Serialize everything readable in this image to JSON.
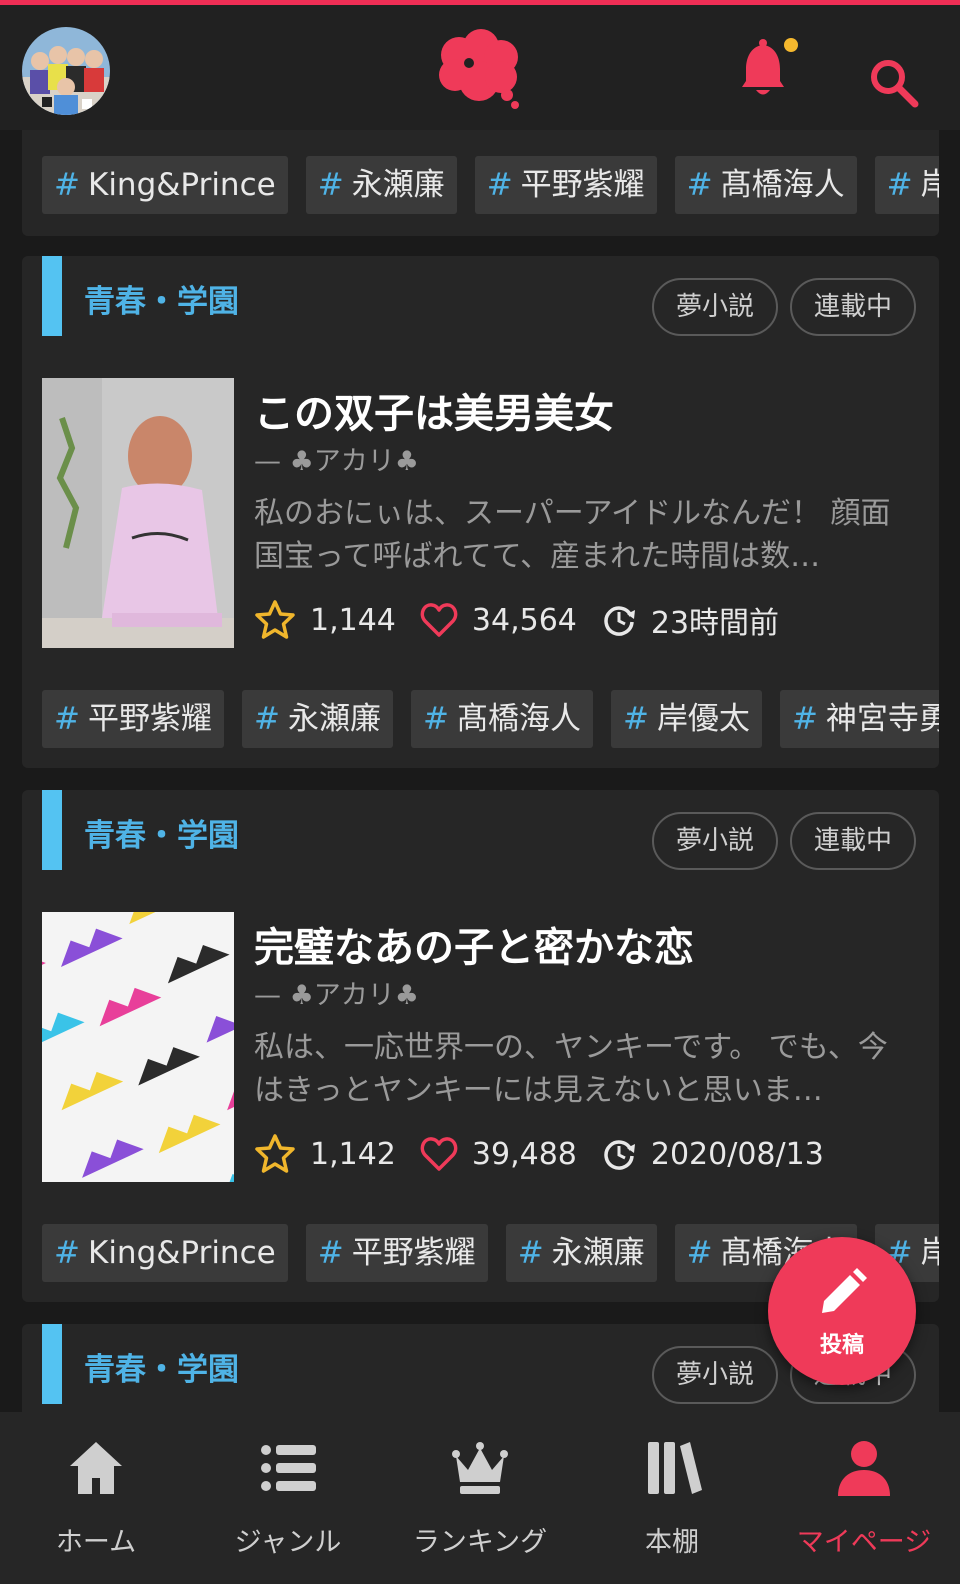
{
  "header": {
    "avatar_icon": "avatar-photo",
    "logo_icon": "speech-bubble-logo-icon",
    "notification_icon": "bell-icon",
    "search_icon": "search-icon"
  },
  "top_tags": [
    "King&Prince",
    "永瀬廉",
    "平野紫耀",
    "髙橋海人",
    "岸優"
  ],
  "cards": [
    {
      "genre": "青春・学園",
      "badge1": "夢小説",
      "badge2": "連載中",
      "title": "この双子は美男美女",
      "author": "— ♣アカリ♣",
      "description": "私のおにぃは、スーパーアイドルなんだ！ 顔面国宝って呼ばれてて、産まれた時間は数…",
      "stars": "1,144",
      "likes": "34,564",
      "updated": "23時間前",
      "tags": [
        "平野紫耀",
        "永瀬廉",
        "髙橋海人",
        "岸優太",
        "神宮寺勇"
      ]
    },
    {
      "genre": "青春・学園",
      "badge1": "夢小説",
      "badge2": "連載中",
      "title": "完璧なあの子と密かな恋",
      "author": "— ♣アカリ♣",
      "description": "私は、一応世界一の、ヤンキーです。 でも、今はきっとヤンキーには見えないと思いま…",
      "stars": "1,142",
      "likes": "39,488",
      "updated": "2020/08/13",
      "tags": [
        "King&Prince",
        "平野紫耀",
        "永瀬廉",
        "髙橋海人",
        "岸優"
      ]
    },
    {
      "genre": "青春・学園",
      "badge1": "夢小説",
      "badge2": "連載中"
    }
  ],
  "fab": {
    "label": "投稿",
    "icon": "pencil-icon"
  },
  "nav": [
    {
      "label": "ホーム",
      "icon": "home-icon"
    },
    {
      "label": "ジャンル",
      "icon": "list-icon"
    },
    {
      "label": "ランキング",
      "icon": "crown-icon"
    },
    {
      "label": "本棚",
      "icon": "bookshelf-icon"
    },
    {
      "label": "マイページ",
      "icon": "person-icon"
    }
  ],
  "colors": {
    "accent": "#ef3a59",
    "genre": "#4fb3e6",
    "background": "#1a1a1a",
    "card": "#262626"
  }
}
